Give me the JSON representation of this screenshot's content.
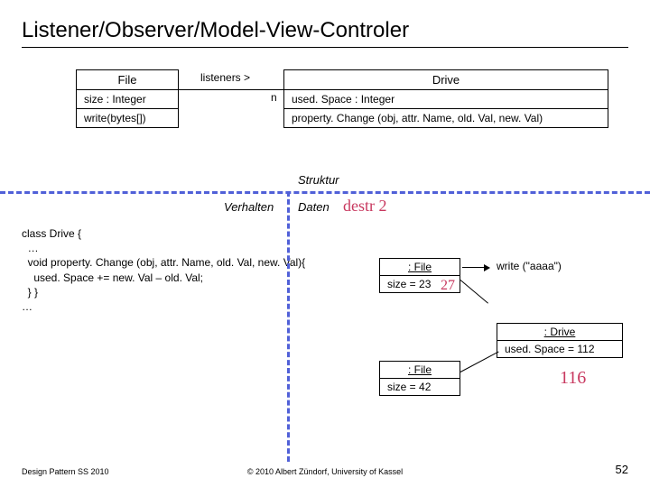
{
  "title": "Listener/Observer/Model-View-Controler",
  "file": {
    "name": "File",
    "attr": "size : Integer",
    "op": "write(bytes[])"
  },
  "drive": {
    "name": "Drive",
    "attr": "used. Space : Integer",
    "op": "property. Change (obj, attr. Name, old. Val, new. Val)"
  },
  "assoc": {
    "label": "listeners >",
    "end": "n"
  },
  "labels": {
    "struktur": "Struktur",
    "verhalten": "Verhalten",
    "daten": "Daten"
  },
  "code": "class Drive {\n  …\n  void property. Change (obj, attr. Name, old. Val, new. Val){\n    used. Space += new. Val – old. Val;\n  } }\n…",
  "call": "write (\"aaaa\")",
  "obj1": {
    "type": ": File",
    "val": "size = 23",
    "hand": "27"
  },
  "obj2": {
    "type": ": File",
    "val": "size = 42"
  },
  "obj3": {
    "type": ": Drive",
    "val": "used. Space = 112"
  },
  "hand": {
    "destr": "destr 2",
    "extra": "116"
  },
  "footer": {
    "left": "Design Pattern SS 2010",
    "center": "© 2010 Albert Zündorf, University of Kassel",
    "page": "52"
  }
}
